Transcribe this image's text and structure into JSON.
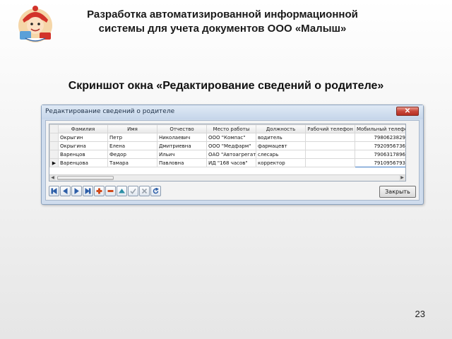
{
  "slide": {
    "title_line1": "Разработка автоматизированной информационной",
    "title_line2": "системы для учета документов ООО «Малыш»",
    "subtitle": "Скриншот окна «Редактирование сведений о родителе»",
    "page_number": "23"
  },
  "window": {
    "title": "Редактирование сведений о родителе",
    "close_label": "✕",
    "grid": {
      "columns": [
        "Фамилия",
        "Имя",
        "Отчество",
        "Место работы",
        "Должность",
        "Рабочий телефон",
        "Мобильный телефон",
        "("
      ],
      "rows": [
        {
          "indicator": "",
          "cells": [
            "Окрыгин",
            "Петр",
            "Николаевич",
            "ООО \"Компас\"",
            "водитель",
            "",
            "7980623829",
            "("
          ]
        },
        {
          "indicator": "",
          "cells": [
            "Окрыгина",
            "Елена",
            "Дмитриевна",
            "ООО \"Медфарм\"",
            "фармацевт",
            "",
            "7920956736",
            "("
          ]
        },
        {
          "indicator": "",
          "cells": [
            "Варенцов",
            "Федор",
            "Ильич",
            "ОАО \"Автоагрегат\"",
            "слесарь",
            "",
            "7906317896",
            "("
          ]
        },
        {
          "indicator": "▶",
          "cells": [
            "Варенцова",
            "Тамара",
            "Павловна",
            "ИД \"168 часов\"",
            "корректор",
            "",
            "7910956793",
            "("
          ]
        }
      ]
    },
    "navigator": [
      {
        "name": "first-record-icon",
        "color": "#2e5fa8"
      },
      {
        "name": "prior-record-icon",
        "color": "#2e5fa8"
      },
      {
        "name": "next-record-icon",
        "color": "#2e5fa8"
      },
      {
        "name": "last-record-icon",
        "color": "#2e5fa8"
      },
      {
        "name": "insert-record-icon",
        "color": "#d04a1c"
      },
      {
        "name": "delete-record-icon",
        "color": "#d04a1c"
      },
      {
        "name": "edit-record-icon",
        "color": "#2c8fa6"
      },
      {
        "name": "post-edit-icon",
        "color": "#9aa3ad"
      },
      {
        "name": "cancel-edit-icon",
        "color": "#9aa3ad"
      },
      {
        "name": "refresh-icon",
        "color": "#2e5fa8"
      }
    ],
    "close_button_label": "Закрыть"
  }
}
